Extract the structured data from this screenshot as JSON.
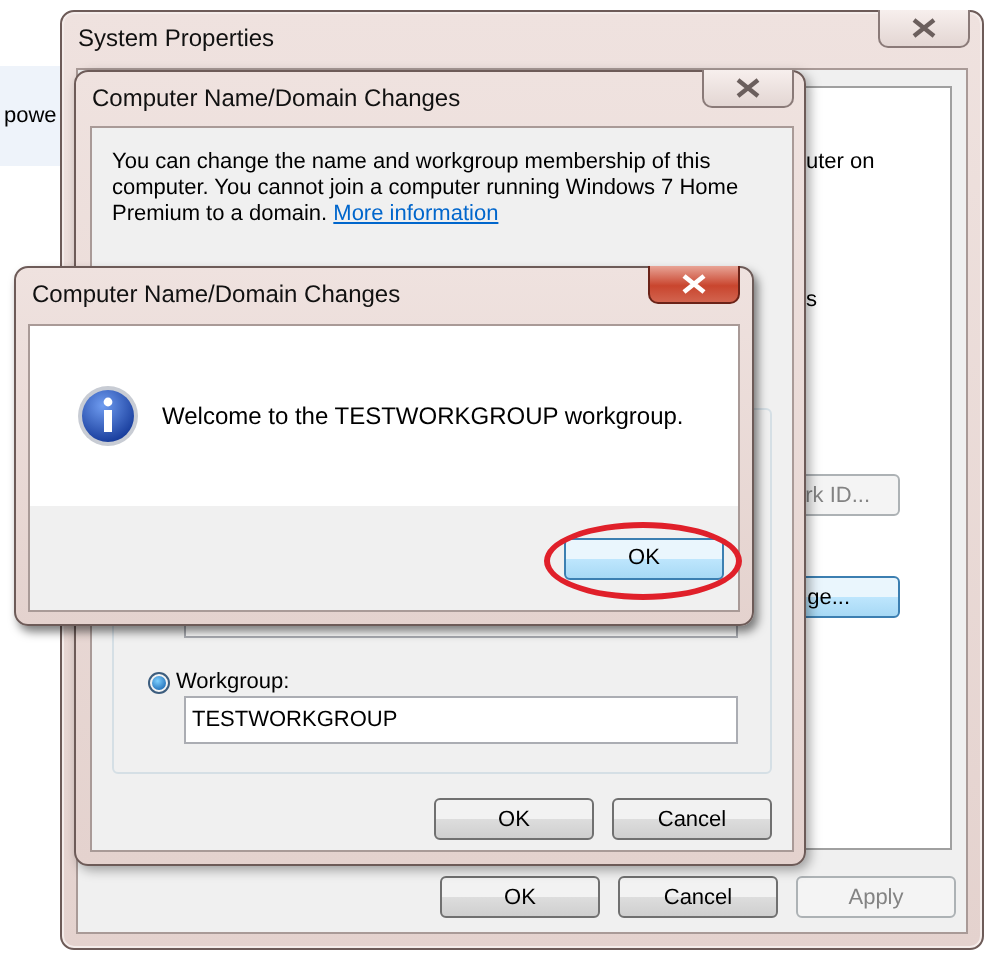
{
  "background_page": {
    "text": "powe"
  },
  "system_properties": {
    "title": "System Properties",
    "partial_texts": [
      "uter on",
      "s"
    ],
    "hidden_buttons": [
      {
        "label": "rk ID...",
        "disabled": true,
        "focused": false
      },
      {
        "label": "ge...",
        "disabled": false,
        "focused": true
      }
    ],
    "buttons": [
      {
        "label": "OK",
        "disabled": false
      },
      {
        "label": "Cancel",
        "disabled": false
      },
      {
        "label": "Apply",
        "disabled": true
      }
    ]
  },
  "name_dialog": {
    "title": "Computer Name/Domain Changes",
    "description": "You can change the name and workgroup membership of this computer. You cannot join a computer running Windows 7 Home Premium to a domain.",
    "link": "More information",
    "workgroup": {
      "label": "Workgroup:",
      "selected": true,
      "value": "TESTWORKGROUP"
    },
    "buttons": [
      {
        "label": "OK",
        "disabled": false
      },
      {
        "label": "Cancel",
        "disabled": false
      }
    ]
  },
  "message_box": {
    "title": "Computer Name/Domain Changes",
    "message": "Welcome to the TESTWORKGROUP workgroup.",
    "button": {
      "label": "OK",
      "focused": true
    },
    "highlighted": true
  }
}
